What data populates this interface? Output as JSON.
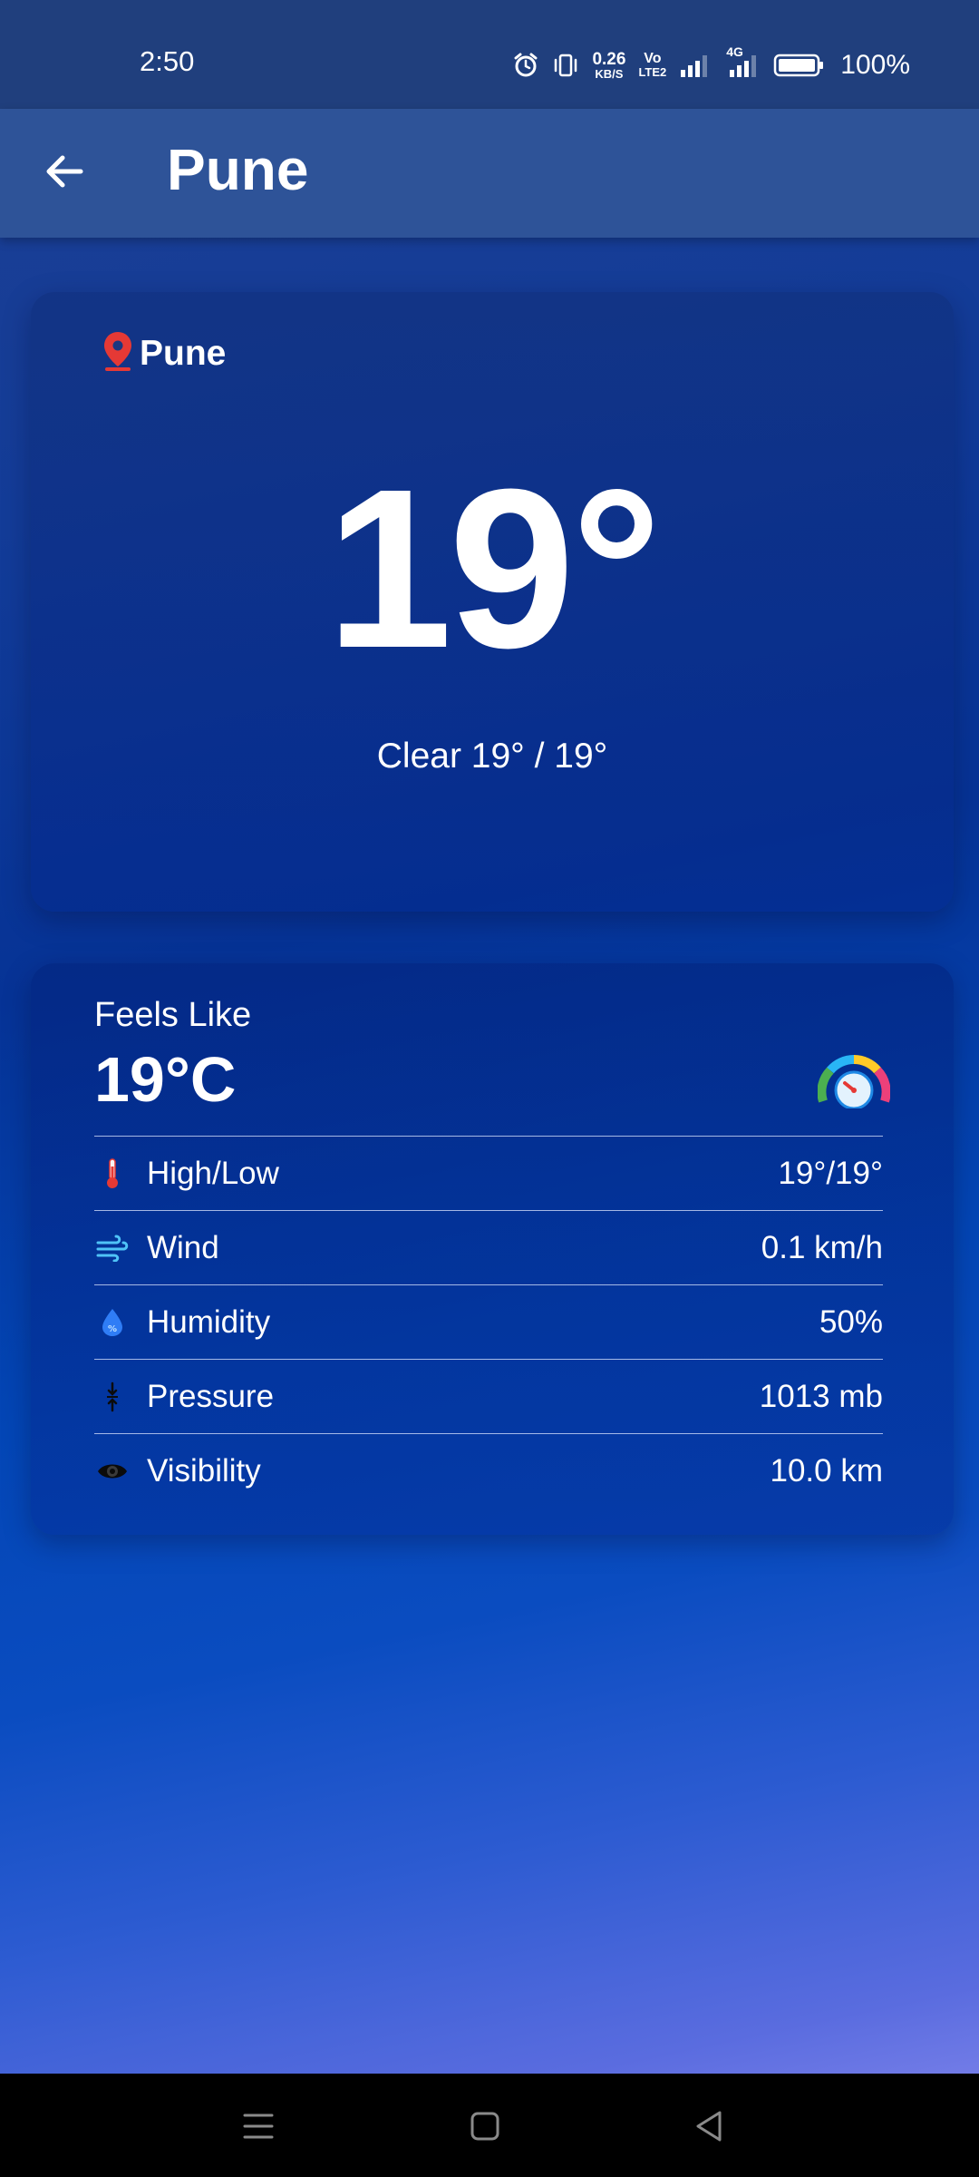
{
  "status_bar": {
    "time": "2:50",
    "net_speed_value": "0.26",
    "net_speed_unit": "KB/S",
    "volte_top": "Vo",
    "volte_bottom": "LTE2",
    "network_type": "4G",
    "battery_percent": "100%"
  },
  "app_bar": {
    "title": "Pune"
  },
  "current": {
    "location": "Pune",
    "temperature": "19°",
    "condition_line": "Clear 19° / 19°"
  },
  "details": {
    "feels_like_label": "Feels Like",
    "feels_like_value": "19°C",
    "rows": [
      {
        "icon": "thermometer-icon",
        "label": "High/Low",
        "value": "19°/19°"
      },
      {
        "icon": "wind-icon",
        "label": "Wind",
        "value": "0.1 km/h"
      },
      {
        "icon": "humidity-drop-icon",
        "label": "Humidity",
        "value": "50%"
      },
      {
        "icon": "pressure-arrows-icon",
        "label": "Pressure",
        "value": "1013 mb"
      },
      {
        "icon": "eye-icon",
        "label": "Visibility",
        "value": "10.0 km"
      }
    ]
  },
  "colors": {
    "status_bar_bg": "#203f7d",
    "app_bar_bg": "#2e5398",
    "location_pin": "#e53935",
    "thermometer_red": "#e53935",
    "wind_blue": "#4fc3f7",
    "drop_blue": "#2f7df6"
  }
}
